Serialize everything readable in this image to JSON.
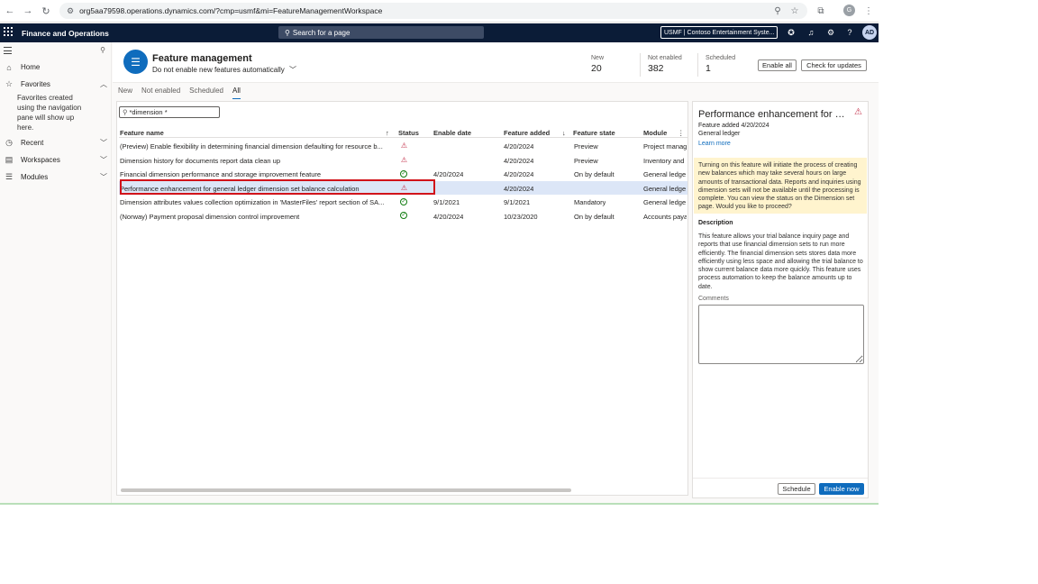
{
  "browser": {
    "url": "org5aa79598.operations.dynamics.com/?cmp=usmf&mi=FeatureManagementWorkspace",
    "profile_initial": "G"
  },
  "appbar": {
    "title": "Finance and Operations",
    "search_placeholder": "Search for a page",
    "company": "USMF | Contoso Entertainment Syste...",
    "user_initials": "AD"
  },
  "leftnav": {
    "items": [
      {
        "label": "Home",
        "icon": "home-icon"
      },
      {
        "label": "Favorites",
        "icon": "star-icon"
      },
      {
        "label": "Recent",
        "icon": "clock-icon"
      },
      {
        "label": "Workspaces",
        "icon": "workspaces-icon"
      },
      {
        "label": "Modules",
        "icon": "modules-icon"
      }
    ],
    "favorites_note": "Favorites created using the navigation pane will show up here."
  },
  "header": {
    "title": "Feature management",
    "subtitle": "Do not enable new features automatically",
    "kpis": [
      {
        "label": "New",
        "value": "20"
      },
      {
        "label": "Not enabled",
        "value": "382"
      },
      {
        "label": "Scheduled",
        "value": "1"
      }
    ],
    "enable_all": "Enable all",
    "check_updates": "Check for updates"
  },
  "tabs": [
    "New",
    "Not enabled",
    "Scheduled",
    "All"
  ],
  "active_tab": "All",
  "filter": {
    "value": "*dimension *"
  },
  "grid": {
    "columns": [
      "Feature name",
      "Status",
      "Enable date",
      "Feature added",
      "Feature state",
      "Module"
    ],
    "rows": [
      {
        "name": "(Preview) Enable flexibility in determining financial dimension defaulting for resource b...",
        "status": "warning",
        "enable_date": "",
        "added": "4/20/2024",
        "state": "Preview",
        "module": "Project manag"
      },
      {
        "name": "Dimension history for documents report data clean up",
        "status": "warning",
        "enable_date": "",
        "added": "4/20/2024",
        "state": "Preview",
        "module": "Inventory and"
      },
      {
        "name": "Financial dimension performance and storage improvement feature",
        "status": "enabled",
        "enable_date": "4/20/2024",
        "added": "4/20/2024",
        "state": "On by default",
        "module": "General ledge"
      },
      {
        "name": "Performance enhancement for general ledger dimension set balance calculation",
        "status": "warning",
        "enable_date": "",
        "added": "4/20/2024",
        "state": "",
        "module": "General ledge"
      },
      {
        "name": "Dimension attributes values collection optimization in 'MasterFiles' report section of SA...",
        "status": "enabled",
        "enable_date": "9/1/2021",
        "added": "9/1/2021",
        "state": "Mandatory",
        "module": "General ledge"
      },
      {
        "name": "(Norway) Payment proposal dimension control improvement",
        "status": "enabled",
        "enable_date": "4/20/2024",
        "added": "10/23/2020",
        "state": "On by default",
        "module": "Accounts paya"
      }
    ]
  },
  "detail": {
    "title": "Performance enhancement for ge...",
    "added": "Feature added 4/20/2024",
    "module": "General ledger",
    "learn_more": "Learn more",
    "banner": "Turning on this feature will initiate the process of creating new balances which may take several hours on large amounts of transactional data. Reports and inquiries using dimension sets will not be available until the processing is complete. You can view the status on the Dimension set page. Would you like to proceed?",
    "description_label": "Description",
    "description": "This feature allows your trial balance inquiry page and reports that use financial dimension sets to run more efficiently. The financial dimension sets stores data more efficiently using less space and allowing the trial balance to show current balance data more quickly. This feature uses process automation to keep the balance amounts up to date.",
    "comments_label": "Comments",
    "schedule": "Schedule",
    "enable_now": "Enable now"
  }
}
